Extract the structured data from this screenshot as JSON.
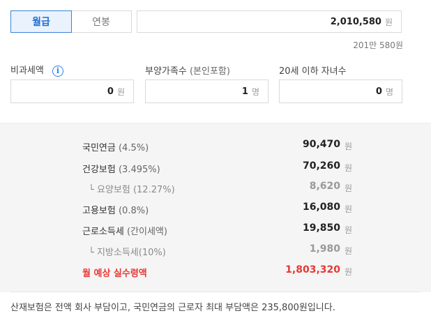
{
  "tabs": {
    "monthly": "월급",
    "annual": "연봉"
  },
  "salary": {
    "value": "2,010,580",
    "unit": "원",
    "readable": "201만 580원"
  },
  "fields": {
    "nontax": {
      "label": "비과세액",
      "value": "0",
      "unit": "원",
      "info_icon": "i"
    },
    "dependents": {
      "label": "부양가족수",
      "label_sub": "(본인포함)",
      "value": "1",
      "unit": "명"
    },
    "children": {
      "label": "20세 이하 자녀수",
      "value": "0",
      "unit": "명"
    }
  },
  "results": [
    {
      "name": "국민연금",
      "pct": "(4.5%)",
      "amount": "90,470",
      "unit": "원"
    },
    {
      "name": "건강보험",
      "pct": "(3.495%)",
      "amount": "70,260",
      "unit": "원"
    },
    {
      "name": "요양보험",
      "pct": "(12.27%)",
      "amount": "8,620",
      "unit": "원"
    },
    {
      "name": "고용보험",
      "pct": "(0.8%)",
      "amount": "16,080",
      "unit": "원"
    },
    {
      "name": "근로소득세",
      "pct": "(간이세액)",
      "amount": "19,850",
      "unit": "원"
    },
    {
      "name": "지방소득세",
      "pct": "(10%)",
      "amount": "1,980",
      "unit": "원"
    },
    {
      "name": "월 예상 실수령액",
      "pct": "",
      "amount": "1,803,320",
      "unit": "원"
    }
  ],
  "note": "산재보험은 전액 회사 부담이고, 국민연금의 근로자 최대 부담액은 235,800원입니다.",
  "colors": {
    "accent": "#1f6fd1",
    "total": "#e53935",
    "panel": "#f5f5f5"
  }
}
